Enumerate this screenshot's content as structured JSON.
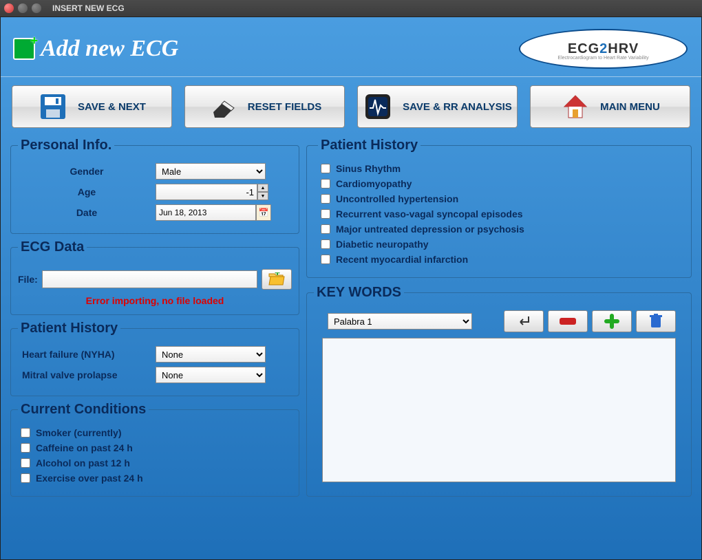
{
  "window": {
    "title": "INSERT NEW ECG"
  },
  "header": {
    "title": "Add new ECG",
    "logo_main": "ECG",
    "logo_two": "2",
    "logo_end": "HRV",
    "logo_sub": "Electrocardiogram to Heart Rate Variability"
  },
  "toolbar": {
    "save_next": "SAVE & NEXT",
    "reset": "RESET FIELDS",
    "save_rr": "SAVE & RR ANALYSIS",
    "main_menu": "MAIN MENU"
  },
  "personal": {
    "legend": "Personal Info.",
    "gender_label": "Gender",
    "gender_value": "Male",
    "age_label": "Age",
    "age_value": "-1",
    "date_label": "Date",
    "date_value": "Jun 18, 2013"
  },
  "ecg_data": {
    "legend": "ECG Data",
    "file_label": "File:",
    "file_value": "",
    "error": "Error importing, no file loaded"
  },
  "patient_history_left": {
    "legend": "Patient History",
    "hf_label": "Heart failure (NYHA)",
    "hf_value": "None",
    "mvp_label": "Mitral valve prolapse",
    "mvp_value": "None"
  },
  "current_conditions": {
    "legend": "Current Conditions",
    "items": [
      "Smoker (currently)",
      "Caffeine on past 24 h",
      "Alcohol on past 12 h",
      "Exercise over past 24 h"
    ]
  },
  "patient_history_right": {
    "legend": "Patient History",
    "items": [
      "Sinus Rhythm",
      "Cardiomyopathy",
      " Uncontrolled hypertension",
      "Recurrent vaso-vagal syncopal episodes",
      "Major untreated depression or psychosis",
      "Diabetic neuropathy",
      "Recent myocardial infarction"
    ]
  },
  "keywords": {
    "legend": "KEY WORDS",
    "selected": "Palabra 1"
  }
}
